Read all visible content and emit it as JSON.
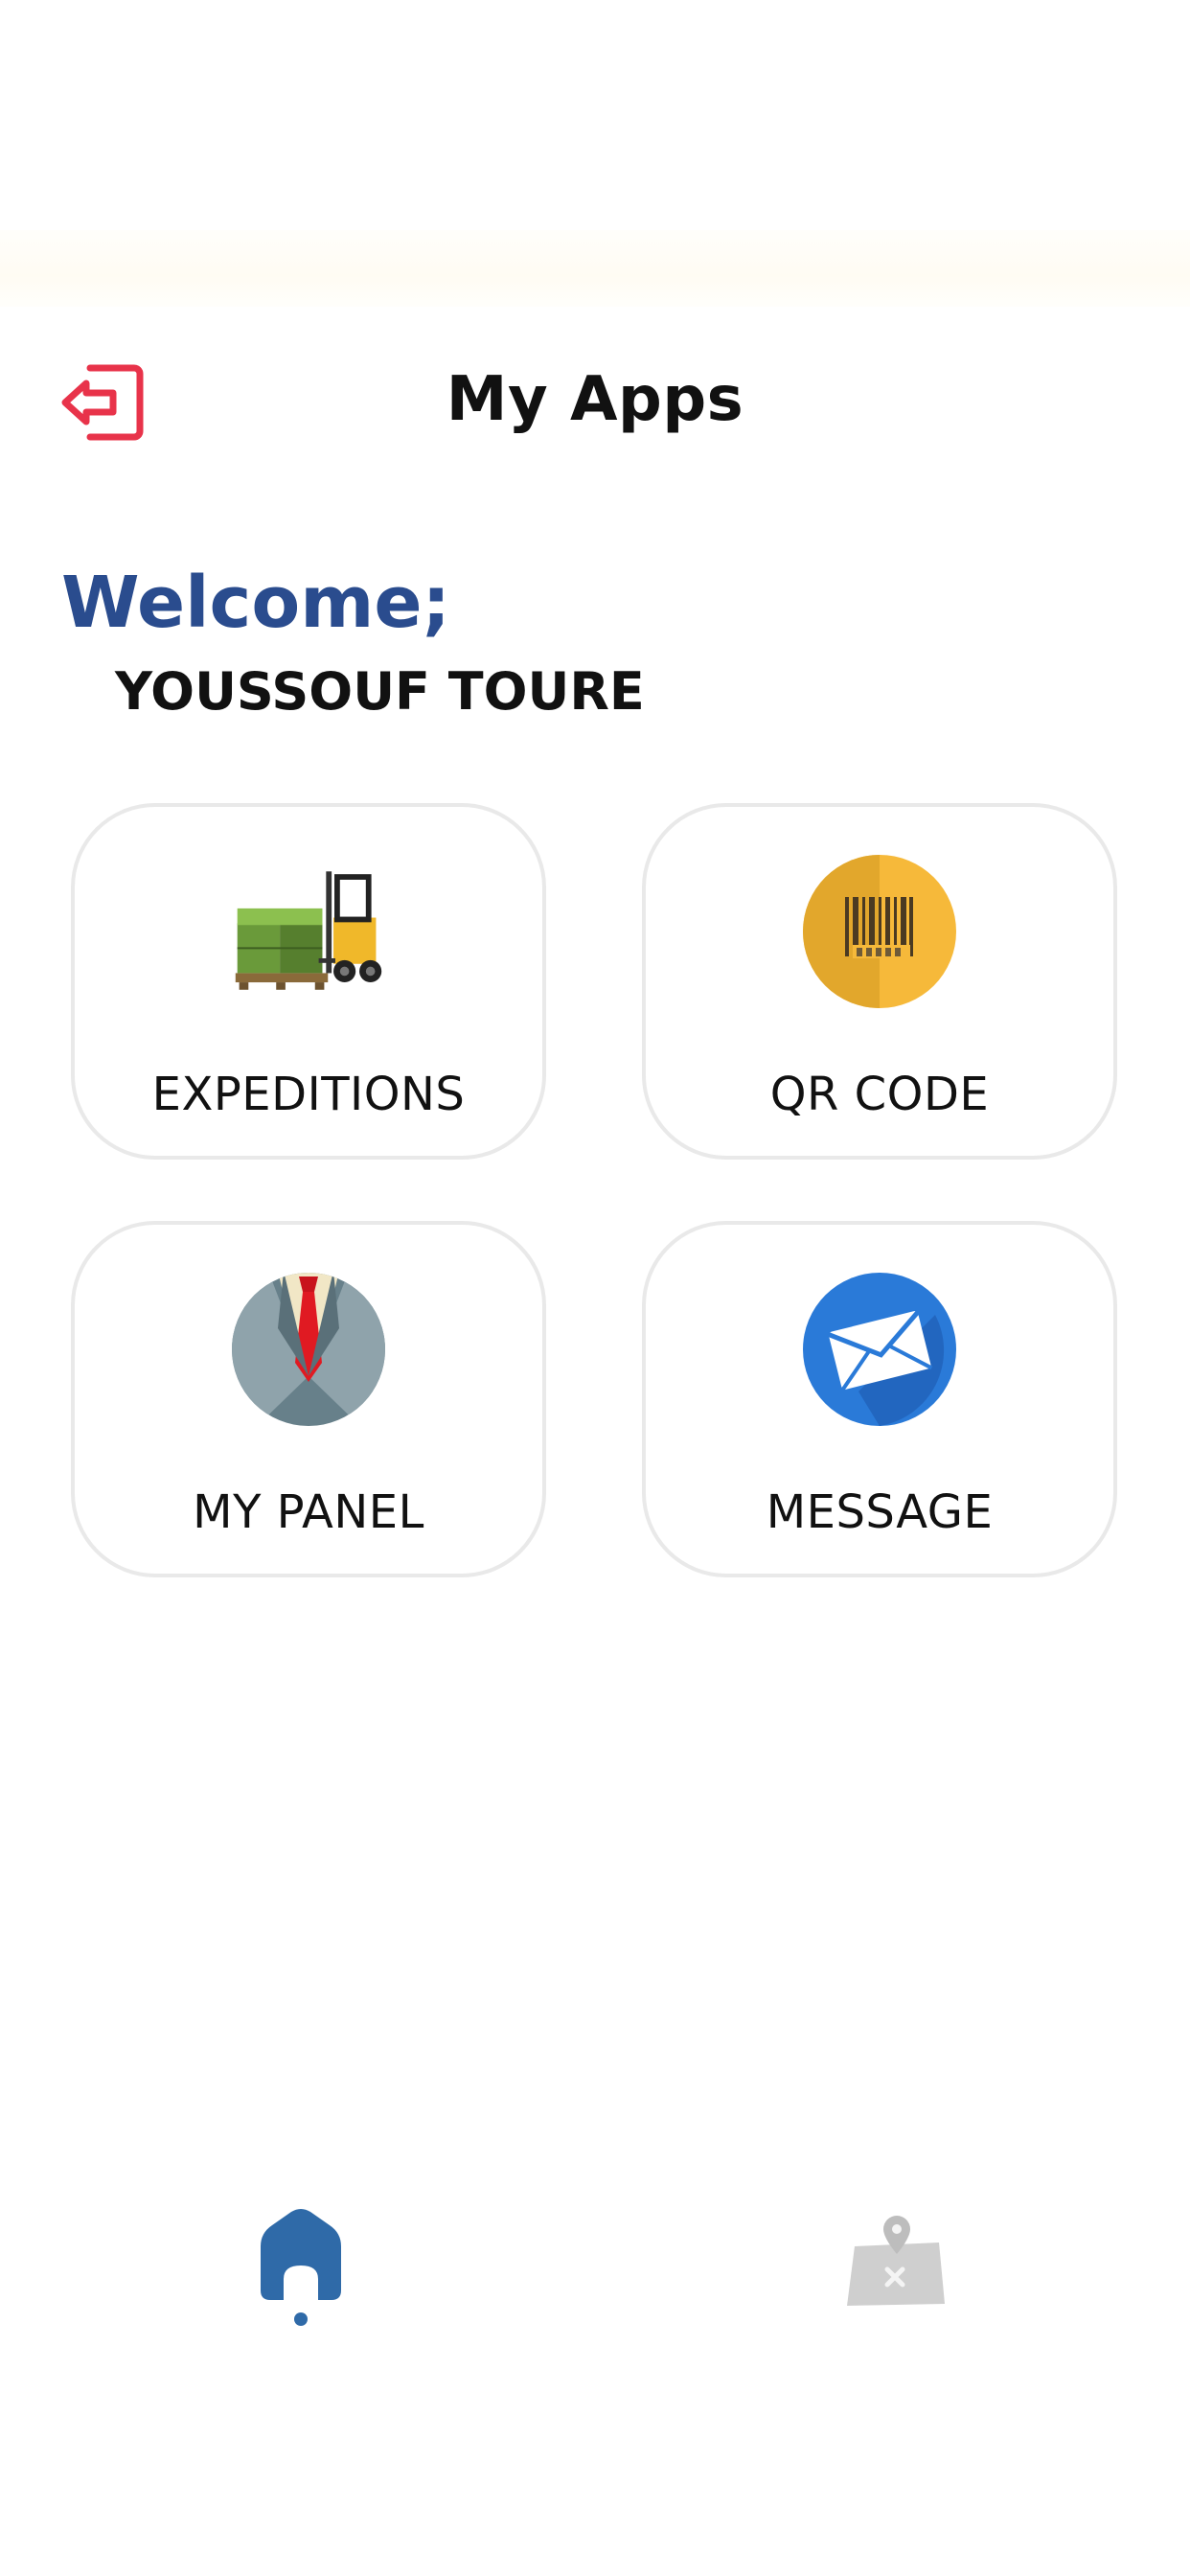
{
  "header": {
    "title": "My Apps",
    "logout_icon": "logout-icon",
    "logout_color": "#e8334a"
  },
  "welcome": {
    "greeting": "Welcome;",
    "user_name": "YOUSSOUF TOURE",
    "greeting_color": "#2a4c8e"
  },
  "apps": [
    {
      "label": "EXPEDITIONS",
      "icon": "forklift-pallet-icon"
    },
    {
      "label": "QR CODE",
      "icon": "barcode-icon"
    },
    {
      "label": "MY PANEL",
      "icon": "suit-tie-icon"
    },
    {
      "label": "MESSAGE",
      "icon": "envelope-icon"
    }
  ],
  "bottom_nav": {
    "items": [
      {
        "icon": "home-icon",
        "active": true,
        "color": "#2f6aa8"
      },
      {
        "icon": "map-pin-icon",
        "active": false,
        "color": "#c8c8c8"
      }
    ]
  }
}
